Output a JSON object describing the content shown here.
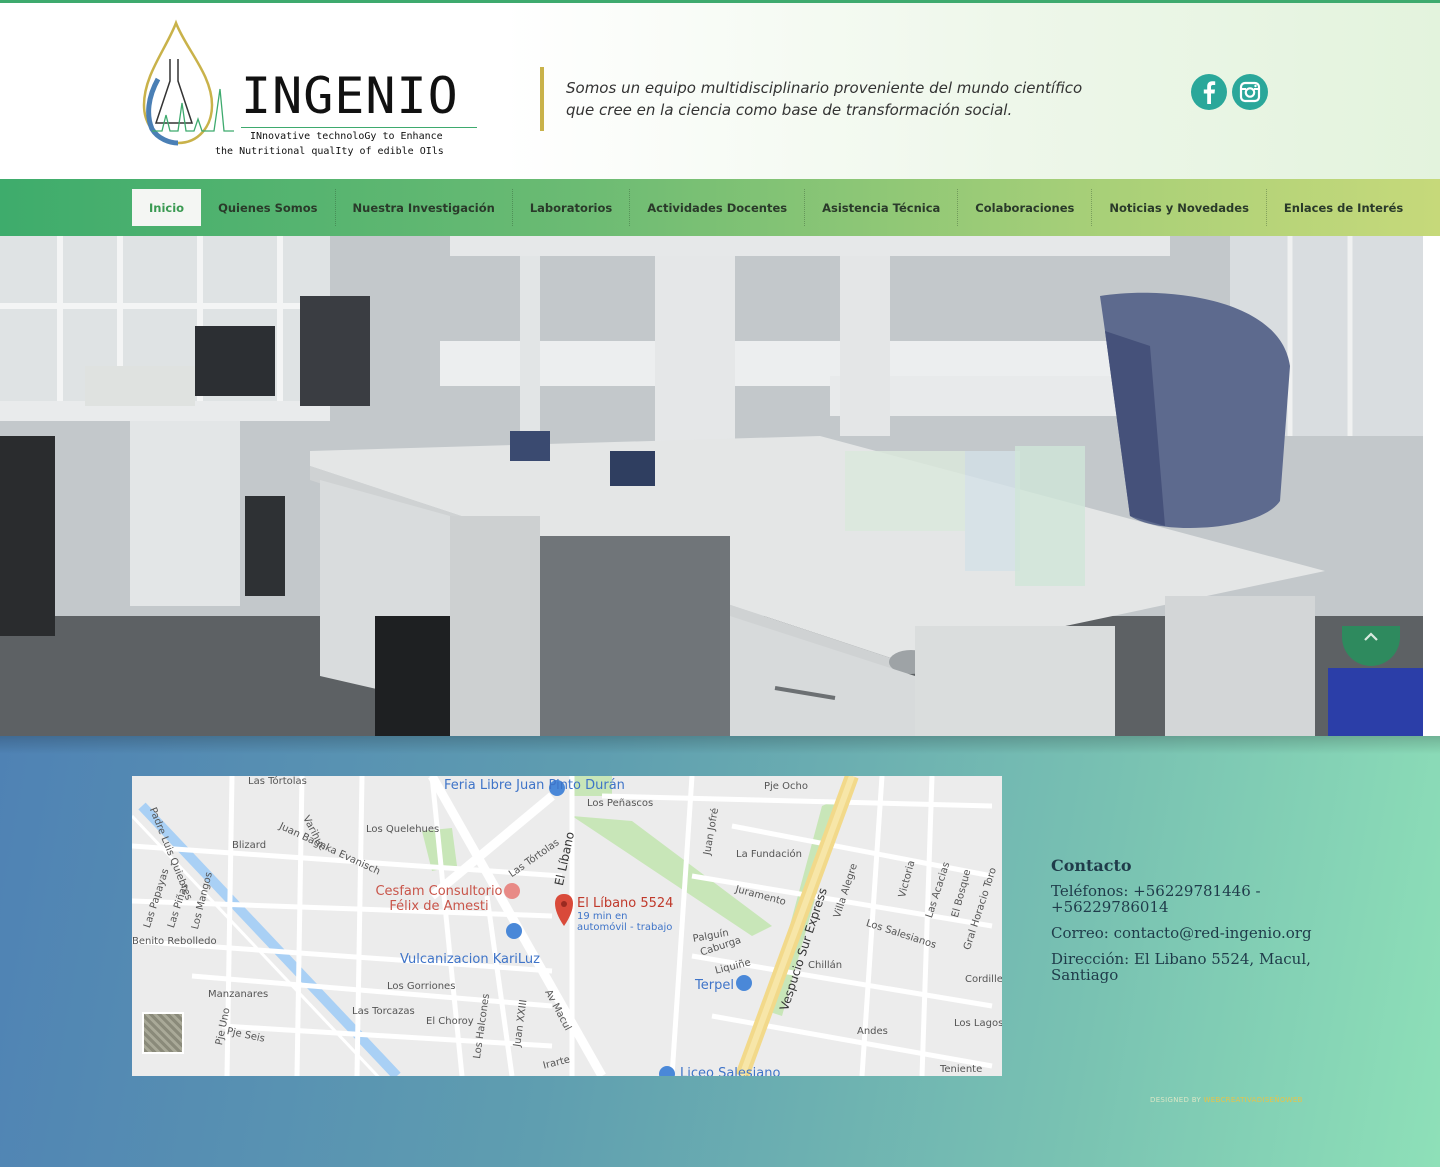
{
  "header": {
    "logo_title": "INGENIO",
    "logo_sub1": "INnovative technoloGy to Enhance",
    "logo_sub2": "the Nutritional qualIty of edible OIls",
    "tagline": "Somos un equipo multidisciplinario proveniente del mundo científico que cree en la ciencia como base de transformación social.",
    "social_icons": [
      "facebook-icon",
      "instagram-icon"
    ]
  },
  "nav": {
    "items": [
      {
        "label": "Inicio",
        "active": true
      },
      {
        "label": "Quienes Somos"
      },
      {
        "label": "Nuestra Investigación"
      },
      {
        "label": "Laboratorios"
      },
      {
        "label": "Actividades Docentes"
      },
      {
        "label": "Asistencia Técnica"
      },
      {
        "label": "Colaboraciones"
      },
      {
        "label": "Noticias y Novedades"
      },
      {
        "label": "Enlaces de Interés"
      }
    ]
  },
  "map": {
    "streets": [
      "Las Tórtolas",
      "Los Quelehues",
      "Blizard",
      "Juan Bagnka Evanisch",
      "Varihue",
      "Las Tórtolas",
      "Los Peñascos",
      "Pje Ocho",
      "Juan Jofré",
      "La Fundación",
      "Juramento",
      "Villa Alegre",
      "Victoria",
      "Las Acacias",
      "El Bosque",
      "Gral Horacio Toro",
      "Chillán",
      "Los Salesianos",
      "Cordiller",
      "Los Lagos",
      "Andes",
      "Teniente",
      "Manzanares",
      "Los Gorriones",
      "Las Torcazas",
      "El Choroy",
      "Los Halcones",
      "Juan XXIII",
      "Av Macul",
      "Padre Luis Quiebres",
      "Las Papayas",
      "Las Piñas",
      "Los Mangos",
      "Benito Rebolledo",
      "Pje Uno",
      "Pje Seis",
      "Palguín",
      "Caburga",
      "Liquiñe",
      "Vespucio Sur Express",
      "El Líbano",
      "Irarte"
    ],
    "pois": {
      "feria": "Feria Libre Juan Pinto Durán",
      "cesfam": "Cesfam Consultorio Félix de Amesti",
      "vulcanizacion": "Vulcanizacion KariLuz",
      "terpel": "Terpel",
      "liceo": "Liceo Salesiano"
    },
    "pin_title": "El Líbano 5524",
    "pin_sub1": "19 min en",
    "pin_sub2": "automóvil - trabajo"
  },
  "contact": {
    "title": "Contacto",
    "phones": "Teléfonos: +56229781446 - +56229786014",
    "email": "Correo: contacto@red-ingenio.org",
    "address": "Dirección: El Libano 5524, Macul, Santiago"
  },
  "footer": {
    "designed_prefix": "DESIGNED BY",
    "designed_brand": "WEBCREATIVADISEÑOWEB"
  },
  "colors": {
    "accent_green": "#3eaa6e",
    "social_teal": "#2aa79a",
    "tagline_bar": "#c9b24a"
  }
}
